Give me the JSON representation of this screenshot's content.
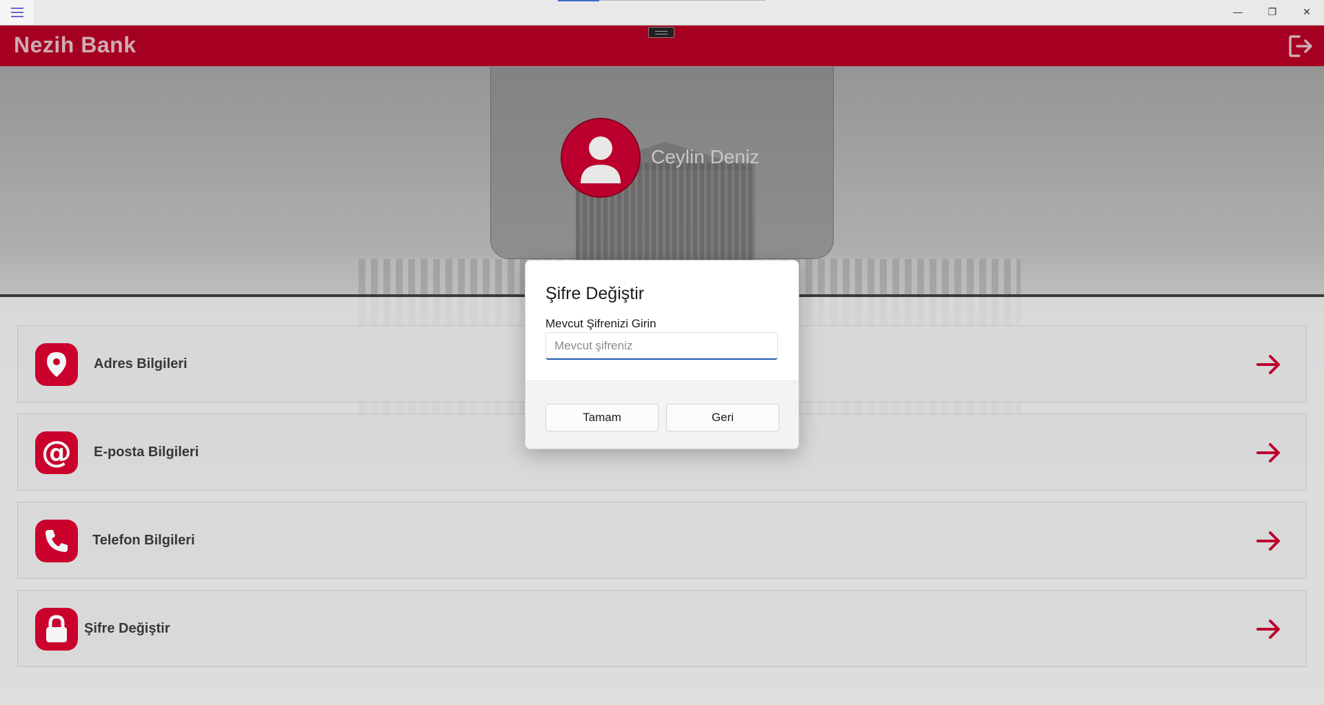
{
  "window": {
    "menu_icon": "hamburger-icon",
    "controls": {
      "minimize": "minimize-icon",
      "restore": "restore-icon",
      "close": "close-icon"
    }
  },
  "header": {
    "brand": "Nezih Bank",
    "logout_icon": "logout-icon",
    "accent_color": "#ac0023"
  },
  "profile": {
    "name": "Ceylin  Deniz",
    "avatar_icon": "user-avatar-icon"
  },
  "menu": {
    "items": [
      {
        "label": "Adres Bilgileri",
        "icon": "location-pin-icon"
      },
      {
        "label": "E-posta Bilgileri",
        "icon": "at-sign-icon"
      },
      {
        "label": "Telefon Bilgileri",
        "icon": "phone-icon"
      },
      {
        "label": "Şifre Değiştir",
        "icon": "lock-icon"
      }
    ],
    "arrow_icon": "arrow-right-icon",
    "icon_color": "#d3002f"
  },
  "dialog": {
    "title": "Şifre Değiştir",
    "field_label": "Mevcut Şifrenizi Girin",
    "field_placeholder": "Mevcut şifreniz",
    "ok_label": "Tamam",
    "back_label": "Geri"
  }
}
